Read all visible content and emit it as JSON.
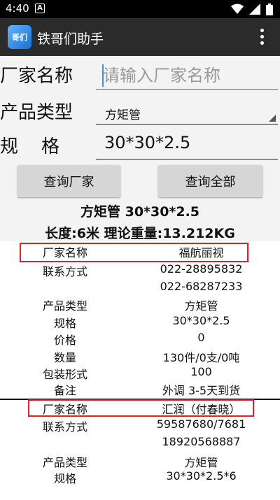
{
  "status": {
    "time": "4:40",
    "notification": "A"
  },
  "app": {
    "title": "铁哥们助手",
    "icon_text": "哥们"
  },
  "form": {
    "labels": {
      "manufacturer": "厂家名称",
      "product_type": "产品类型",
      "spec": "规    格"
    },
    "manufacturer_placeholder": "请输入厂家名称",
    "manufacturer_value": "",
    "product_type_value": "方矩管",
    "spec_value": "30*30*2.5"
  },
  "buttons": {
    "query_manufacturer": "查询厂家",
    "query_all": "查询全部"
  },
  "summary": {
    "line1": "方矩管 30*30*2.5",
    "line2": "长度:6米 理论重量:13.212KG"
  },
  "results": [
    {
      "rows": [
        {
          "label": "厂家名称",
          "value": "福航丽视"
        },
        {
          "label": "联系方式",
          "value": "022-28895832"
        },
        {
          "label": "",
          "value": "022-68287233"
        },
        {
          "label": "产品类型",
          "value": "方矩管"
        },
        {
          "label": "规格",
          "value": "30*30*2.5"
        },
        {
          "label": "价格",
          "value": "0"
        },
        {
          "label": "数量",
          "value": "130件/0支/0吨"
        },
        {
          "label": "包装形式",
          "value": "100"
        },
        {
          "label": "备注",
          "value": "外调 3-5天到货"
        }
      ]
    },
    {
      "rows": [
        {
          "label": "厂家名称",
          "value": "汇润（付春晓）"
        },
        {
          "label": "联系方式",
          "value": "59587680/7681"
        },
        {
          "label": "",
          "value": "18920568887"
        },
        {
          "label": "产品类型",
          "value": "方矩管"
        },
        {
          "label": "规格",
          "value": "30*30*2.5*6"
        }
      ]
    }
  ],
  "colors": {
    "highlight": "#e0202a",
    "app_bar": "#2b2b2b",
    "button": "#d6d6d6"
  }
}
